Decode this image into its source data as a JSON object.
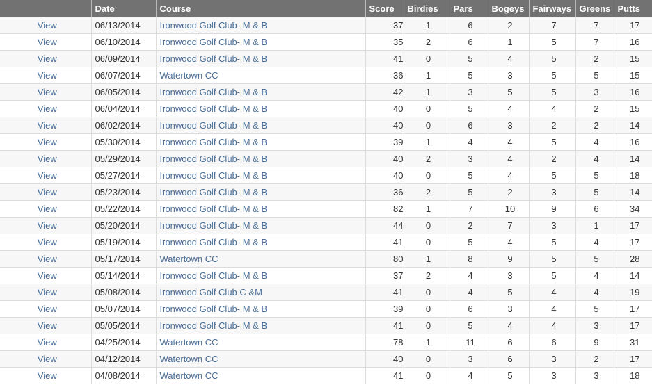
{
  "table": {
    "headers": [
      "",
      "Date",
      "Course",
      "Score",
      "Birdies",
      "Pars",
      "Bogeys",
      "Fairways",
      "Greens",
      "Putts"
    ],
    "view_label": "View",
    "rows": [
      {
        "date": "06/13/2014",
        "course": "Ironwood Golf Club- M & B",
        "score": "37",
        "birdies": "1",
        "pars": "6",
        "bogeys": "2",
        "fairways": "7",
        "greens": "7",
        "putts": "17"
      },
      {
        "date": "06/10/2014",
        "course": "Ironwood Golf Club- M & B",
        "score": "35",
        "birdies": "2",
        "pars": "6",
        "bogeys": "1",
        "fairways": "5",
        "greens": "7",
        "putts": "16"
      },
      {
        "date": "06/09/2014",
        "course": "Ironwood Golf Club- M & B",
        "score": "41",
        "birdies": "0",
        "pars": "5",
        "bogeys": "4",
        "fairways": "5",
        "greens": "2",
        "putts": "15"
      },
      {
        "date": "06/07/2014",
        "course": "Watertown CC",
        "score": "36",
        "birdies": "1",
        "pars": "5",
        "bogeys": "3",
        "fairways": "5",
        "greens": "5",
        "putts": "15"
      },
      {
        "date": "06/05/2014",
        "course": "Ironwood Golf Club- M & B",
        "score": "42",
        "birdies": "1",
        "pars": "3",
        "bogeys": "5",
        "fairways": "5",
        "greens": "3",
        "putts": "16"
      },
      {
        "date": "06/04/2014",
        "course": "Ironwood Golf Club- M & B",
        "score": "40",
        "birdies": "0",
        "pars": "5",
        "bogeys": "4",
        "fairways": "4",
        "greens": "2",
        "putts": "15"
      },
      {
        "date": "06/02/2014",
        "course": "Ironwood Golf Club- M & B",
        "score": "40",
        "birdies": "0",
        "pars": "6",
        "bogeys": "3",
        "fairways": "2",
        "greens": "2",
        "putts": "14"
      },
      {
        "date": "05/30/2014",
        "course": "Ironwood Golf Club- M & B",
        "score": "39",
        "birdies": "1",
        "pars": "4",
        "bogeys": "4",
        "fairways": "5",
        "greens": "4",
        "putts": "16"
      },
      {
        "date": "05/29/2014",
        "course": "Ironwood Golf Club- M & B",
        "score": "40",
        "birdies": "2",
        "pars": "3",
        "bogeys": "4",
        "fairways": "2",
        "greens": "4",
        "putts": "14"
      },
      {
        "date": "05/27/2014",
        "course": "Ironwood Golf Club- M & B",
        "score": "40",
        "birdies": "0",
        "pars": "5",
        "bogeys": "4",
        "fairways": "5",
        "greens": "5",
        "putts": "18"
      },
      {
        "date": "05/23/2014",
        "course": "Ironwood Golf Club- M & B",
        "score": "36",
        "birdies": "2",
        "pars": "5",
        "bogeys": "2",
        "fairways": "3",
        "greens": "5",
        "putts": "14"
      },
      {
        "date": "05/22/2014",
        "course": "Ironwood Golf Club- M & B",
        "score": "82",
        "birdies": "1",
        "pars": "7",
        "bogeys": "10",
        "fairways": "9",
        "greens": "6",
        "putts": "34"
      },
      {
        "date": "05/20/2014",
        "course": "Ironwood Golf Club- M & B",
        "score": "44",
        "birdies": "0",
        "pars": "2",
        "bogeys": "7",
        "fairways": "3",
        "greens": "1",
        "putts": "17"
      },
      {
        "date": "05/19/2014",
        "course": "Ironwood Golf Club- M & B",
        "score": "41",
        "birdies": "0",
        "pars": "5",
        "bogeys": "4",
        "fairways": "5",
        "greens": "4",
        "putts": "17"
      },
      {
        "date": "05/17/2014",
        "course": "Watertown CC",
        "score": "80",
        "birdies": "1",
        "pars": "8",
        "bogeys": "9",
        "fairways": "5",
        "greens": "5",
        "putts": "28"
      },
      {
        "date": "05/14/2014",
        "course": "Ironwood Golf Club- M & B",
        "score": "37",
        "birdies": "2",
        "pars": "4",
        "bogeys": "3",
        "fairways": "5",
        "greens": "4",
        "putts": "14"
      },
      {
        "date": "05/08/2014",
        "course": "Ironwood Golf Club C &M",
        "score": "41",
        "birdies": "0",
        "pars": "4",
        "bogeys": "5",
        "fairways": "4",
        "greens": "4",
        "putts": "19"
      },
      {
        "date": "05/07/2014",
        "course": "Ironwood Golf Club- M & B",
        "score": "39",
        "birdies": "0",
        "pars": "6",
        "bogeys": "3",
        "fairways": "4",
        "greens": "5",
        "putts": "17"
      },
      {
        "date": "05/05/2014",
        "course": "Ironwood Golf Club- M & B",
        "score": "41",
        "birdies": "0",
        "pars": "5",
        "bogeys": "4",
        "fairways": "4",
        "greens": "3",
        "putts": "17"
      },
      {
        "date": "04/25/2014",
        "course": "Watertown CC",
        "score": "78",
        "birdies": "1",
        "pars": "11",
        "bogeys": "6",
        "fairways": "6",
        "greens": "9",
        "putts": "31"
      },
      {
        "date": "04/12/2014",
        "course": "Watertown CC",
        "score": "40",
        "birdies": "0",
        "pars": "3",
        "bogeys": "6",
        "fairways": "3",
        "greens": "2",
        "putts": "17"
      },
      {
        "date": "04/08/2014",
        "course": "Watertown CC",
        "score": "41",
        "birdies": "0",
        "pars": "4",
        "bogeys": "5",
        "fairways": "3",
        "greens": "3",
        "putts": "18"
      }
    ]
  },
  "colors": {
    "header_bg": "#727272",
    "link": "#4a6d97",
    "row_alt": "#f7f7f7"
  }
}
